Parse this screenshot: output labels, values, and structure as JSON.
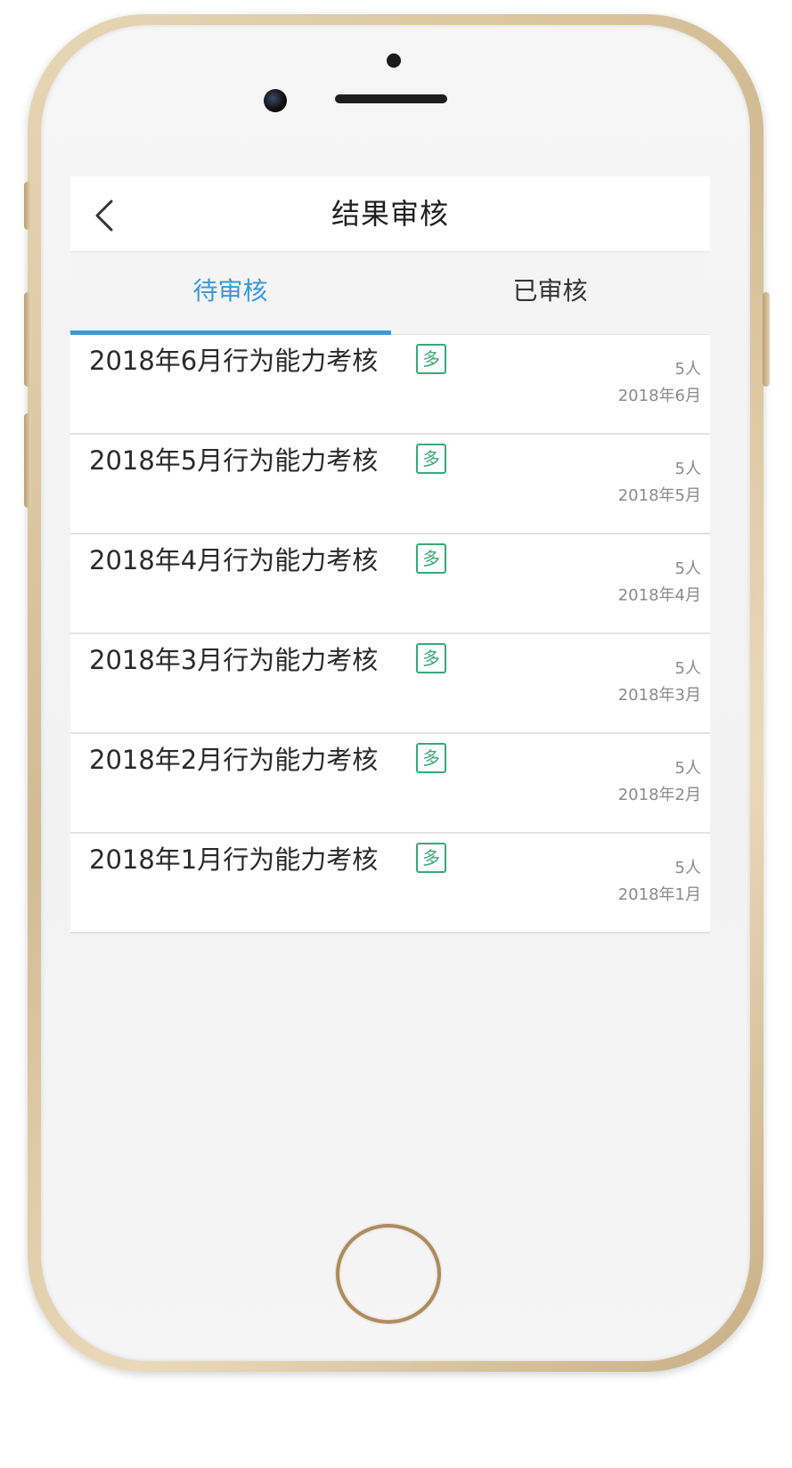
{
  "header": {
    "title": "结果审核",
    "back_icon": "chevron-left-icon"
  },
  "tabs": [
    {
      "label": "待审核",
      "active": true
    },
    {
      "label": "已审核",
      "active": false
    }
  ],
  "colors": {
    "accent": "#3a9ad9",
    "badge": "#3aa876",
    "meta_text": "#8a8a8a"
  },
  "items": [
    {
      "title": "2018年6月行为能力考核",
      "badge": "多",
      "count": "5人",
      "date": "2018年6月"
    },
    {
      "title": "2018年5月行为能力考核",
      "badge": "多",
      "count": "5人",
      "date": "2018年5月"
    },
    {
      "title": "2018年4月行为能力考核",
      "badge": "多",
      "count": "5人",
      "date": "2018年4月"
    },
    {
      "title": "2018年3月行为能力考核",
      "badge": "多",
      "count": "5人",
      "date": "2018年3月"
    },
    {
      "title": "2018年2月行为能力考核",
      "badge": "多",
      "count": "5人",
      "date": "2018年2月"
    },
    {
      "title": "2018年1月行为能力考核",
      "badge": "多",
      "count": "5人",
      "date": "2018年1月"
    }
  ]
}
